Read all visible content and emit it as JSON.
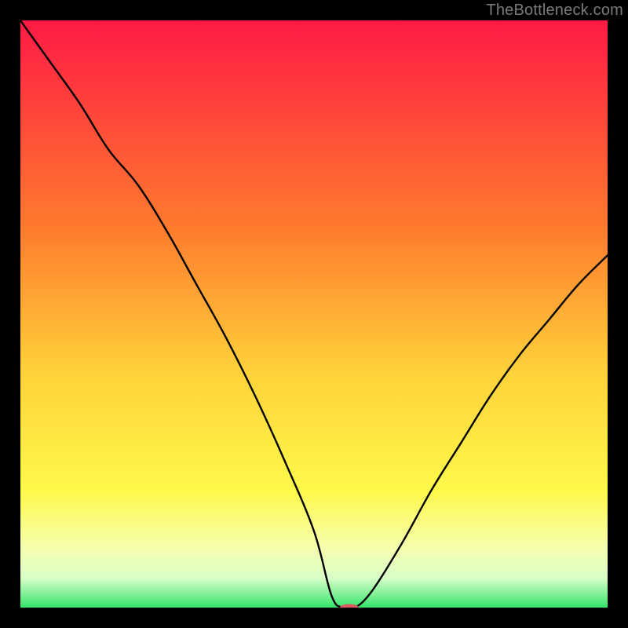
{
  "watermark": "TheBottleneck.com",
  "colors": {
    "black": "#000000",
    "curve": "#000000",
    "marker_fill": "#dd5c63",
    "grad_top": "#ff1a45",
    "grad_mid1": "#ff7a2e",
    "grad_mid2": "#ffd23a",
    "grad_mid3": "#fff94a",
    "grad_low1": "#f6ffb0",
    "grad_low2": "#d8ffc8",
    "grad_bottom": "#36e56b"
  },
  "chart_data": {
    "type": "line",
    "title": "",
    "xlabel": "",
    "ylabel": "",
    "xlim": [
      0,
      100
    ],
    "ylim": [
      0,
      100
    ],
    "series": [
      {
        "name": "bottleneck-curve",
        "x": [
          0,
          5,
          10,
          15,
          20,
          25,
          30,
          35,
          40,
          45,
          50,
          53,
          55,
          57,
          60,
          65,
          70,
          75,
          80,
          85,
          90,
          95,
          100
        ],
        "y": [
          100,
          93,
          86,
          78,
          72,
          64,
          55,
          46,
          36,
          25,
          13,
          2,
          0,
          0,
          3,
          11,
          20,
          28,
          36,
          43,
          49,
          55,
          60
        ]
      }
    ],
    "marker": {
      "x": 56,
      "y": 0,
      "rx": 1.6,
      "ry": 0.6
    },
    "gradient_stops": [
      {
        "offset": 0.0,
        "key": "grad_top"
      },
      {
        "offset": 0.35,
        "key": "grad_mid1"
      },
      {
        "offset": 0.6,
        "key": "grad_mid2"
      },
      {
        "offset": 0.8,
        "key": "grad_mid3"
      },
      {
        "offset": 0.9,
        "key": "grad_low1"
      },
      {
        "offset": 0.95,
        "key": "grad_low2"
      },
      {
        "offset": 1.0,
        "key": "grad_bottom"
      }
    ]
  }
}
